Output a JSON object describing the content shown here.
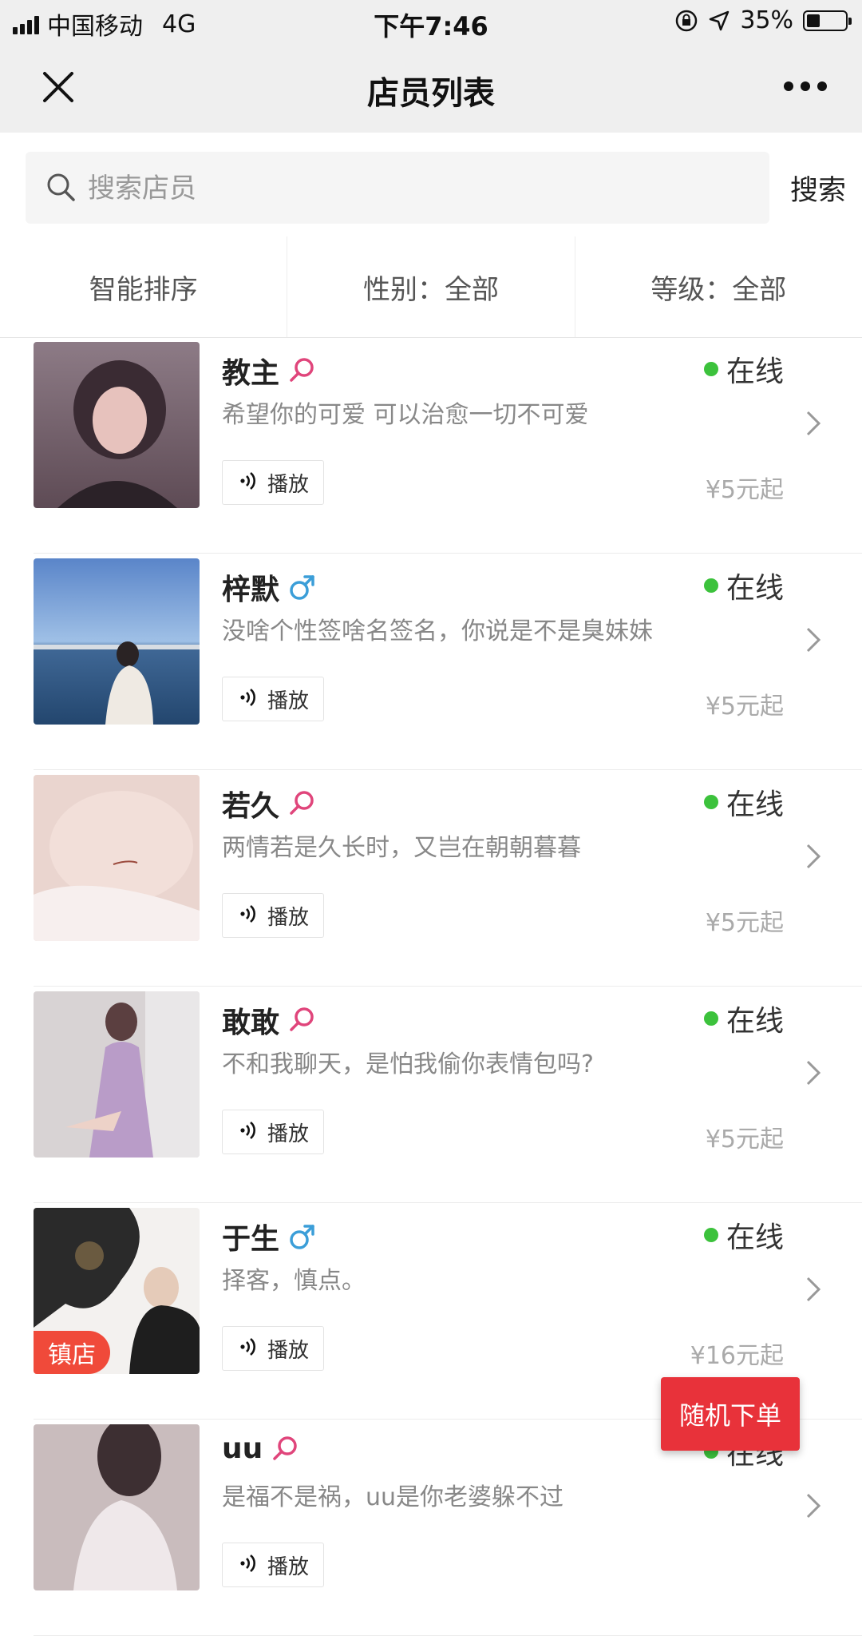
{
  "status_bar": {
    "carrier": "中国移动",
    "network": "4G",
    "time": "下午7:46",
    "battery": "35%",
    "battery_level": 0.35
  },
  "header": {
    "title": "店员列表",
    "close_icon": "close-icon",
    "more_icon": "more-icon"
  },
  "search": {
    "placeholder": "搜索店员",
    "value": "",
    "button_label": "搜索"
  },
  "filters": [
    {
      "label": "智能排序"
    },
    {
      "label": "性别：全部"
    },
    {
      "label": "等级：全部"
    }
  ],
  "colors": {
    "online": "#3cc23c",
    "female": "#e0457b",
    "male": "#3b9ed8",
    "accent": "#e8323a",
    "badge": "#f04a3a"
  },
  "staff": [
    {
      "name": "教主",
      "gender": "female",
      "signature": "希望你的可爱 可以治愈一切不可爱",
      "status": "在线",
      "play_label": "播放",
      "price": "¥5元起",
      "badge": ""
    },
    {
      "name": "梓默",
      "gender": "male",
      "signature": "没啥个性签啥名签名，你说是不是臭妹妹",
      "status": "在线",
      "play_label": "播放",
      "price": "¥5元起",
      "badge": ""
    },
    {
      "name": "若久",
      "gender": "female",
      "signature": "两情若是久长时，又岂在朝朝暮暮",
      "status": "在线",
      "play_label": "播放",
      "price": "¥5元起",
      "badge": ""
    },
    {
      "name": "敢敢",
      "gender": "female",
      "signature": "不和我聊天，是怕我偷你表情包吗?",
      "status": "在线",
      "play_label": "播放",
      "price": "¥5元起",
      "badge": ""
    },
    {
      "name": "于生",
      "gender": "male",
      "signature": "择客，慎点。",
      "status": "在线",
      "play_label": "播放",
      "price": "¥16元起",
      "badge": "镇店"
    },
    {
      "name": "uu",
      "gender": "female",
      "signature": "是福不是祸，uu是你老婆躲不过",
      "status": "在线",
      "play_label": "播放",
      "price": "",
      "badge": ""
    }
  ],
  "random_order": {
    "label": "随机下单"
  }
}
